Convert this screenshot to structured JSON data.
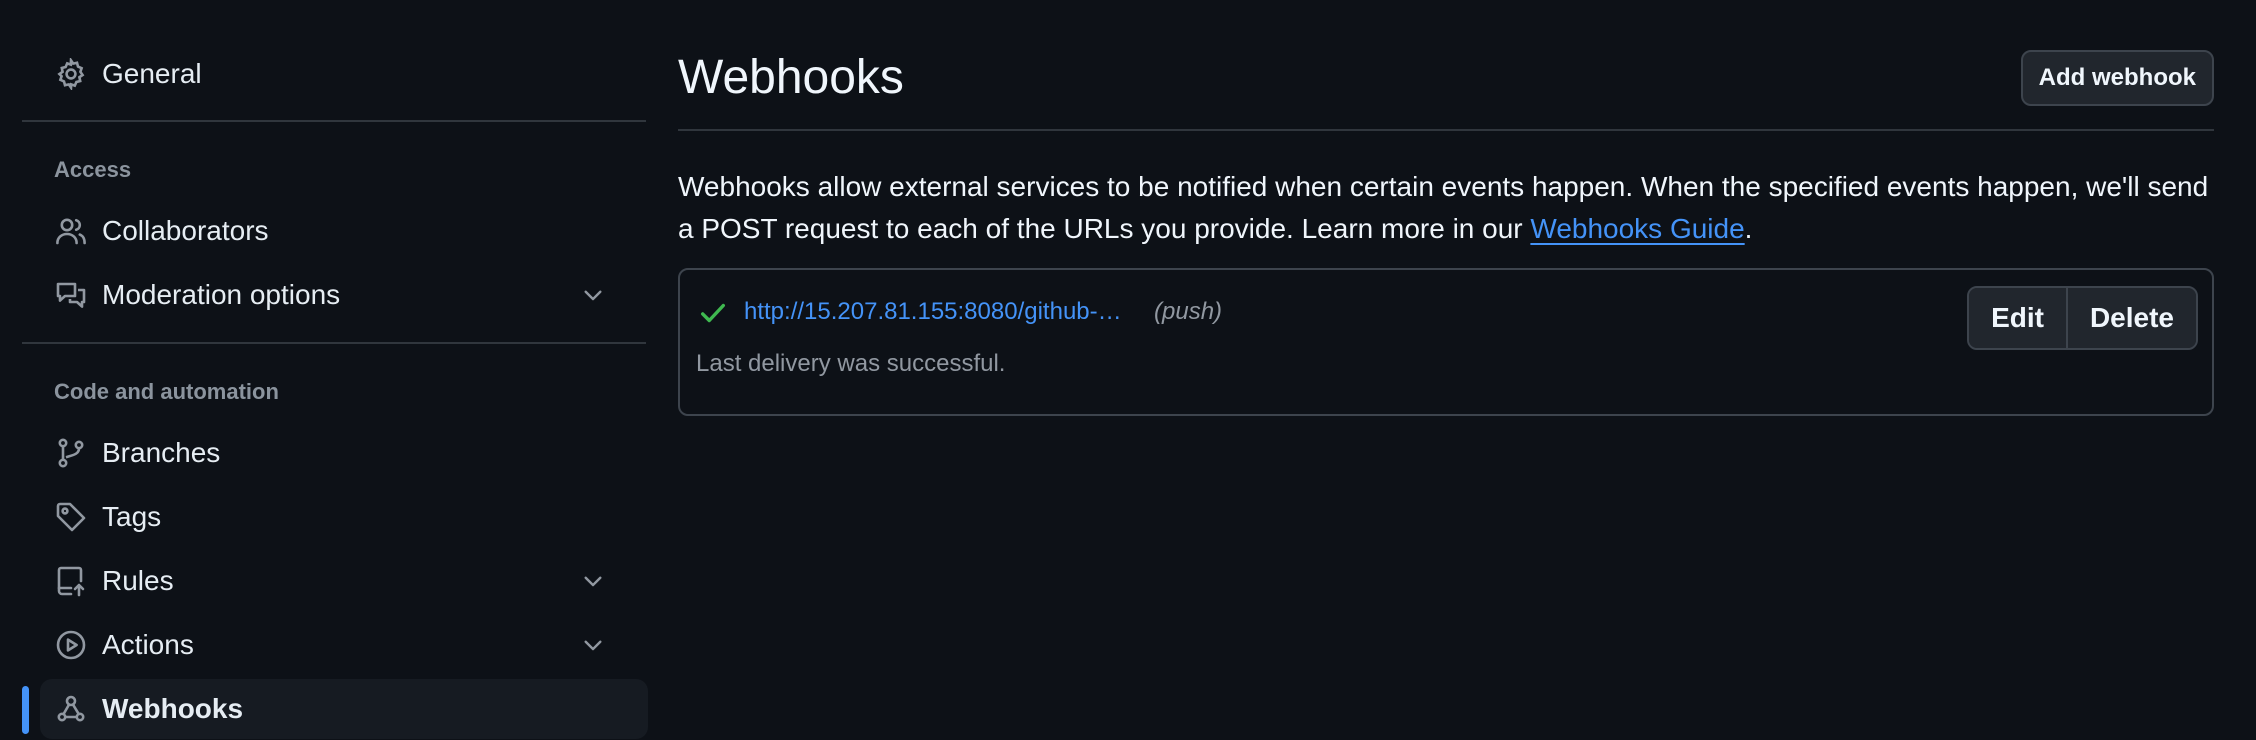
{
  "sidebar": {
    "general": {
      "label": "General",
      "icon": "gear-icon"
    },
    "access_heading": "Access",
    "access_items": [
      {
        "label": "Collaborators",
        "icon": "people-icon"
      },
      {
        "label": "Moderation options",
        "icon": "comment-discussion-icon",
        "expandable": true
      }
    ],
    "code_heading": "Code and automation",
    "code_items": [
      {
        "label": "Branches",
        "icon": "git-branch-icon"
      },
      {
        "label": "Tags",
        "icon": "tag-icon"
      },
      {
        "label": "Rules",
        "icon": "repo-push-icon",
        "expandable": true
      },
      {
        "label": "Actions",
        "icon": "play-icon",
        "expandable": true
      },
      {
        "label": "Webhooks",
        "icon": "webhook-icon",
        "active": true
      }
    ]
  },
  "main": {
    "title": "Webhooks",
    "add_button": "Add webhook",
    "description_text": "Webhooks allow external services to be notified when certain events happen. When the specified events happen, we'll send a POST request to each of the URLs you provide. Learn more in our ",
    "guide_link": "Webhooks Guide",
    "description_end": ".",
    "webhooks": [
      {
        "url": "http://15.207.81.155:8080/github-…",
        "events": "(push)",
        "status": "Last delivery was successful.",
        "edit_label": "Edit",
        "delete_label": "Delete"
      }
    ]
  },
  "colors": {
    "background": "#0d1117",
    "link": "#4493f8",
    "success": "#3fb950",
    "muted": "#9198a1",
    "border": "#3d444d"
  }
}
